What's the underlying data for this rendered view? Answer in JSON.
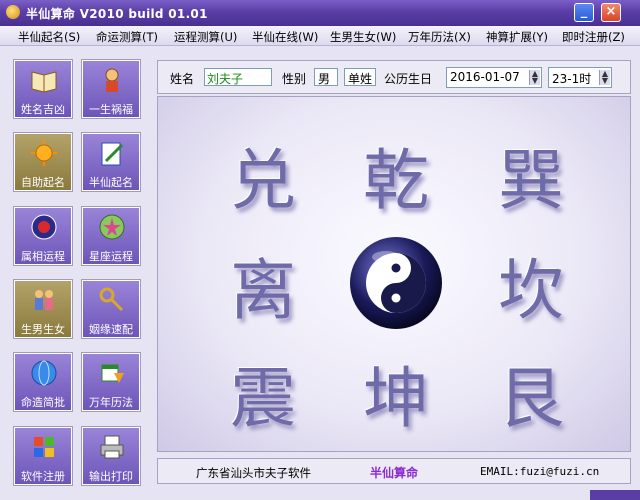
{
  "window": {
    "title": "半仙算命 V2010 build 01.01",
    "min_glyph": "_",
    "close_glyph": "×"
  },
  "menu": [
    "半仙起名(S)",
    "命运测算(T)",
    "运程测算(U)",
    "半仙在线(W)",
    "生男生女(W)",
    "万年历法(X)",
    "神算扩展(Y)",
    "即时注册(Z)"
  ],
  "sidebar": [
    {
      "label": "姓名吉凶",
      "icon": "book-icon"
    },
    {
      "label": "一生祸福",
      "icon": "figure-icon"
    },
    {
      "label": "自助起名",
      "icon": "sun-icon",
      "active": true
    },
    {
      "label": "半仙起名",
      "icon": "pen-paper-icon"
    },
    {
      "label": "属相运程",
      "icon": "zodiac-wheel-icon"
    },
    {
      "label": "星座运程",
      "icon": "star-globe-icon"
    },
    {
      "label": "生男生女",
      "icon": "kids-icon"
    },
    {
      "label": "姻缘速配",
      "icon": "keys-icon"
    },
    {
      "label": "命造简批",
      "icon": "blue-globe-icon"
    },
    {
      "label": "万年历法",
      "icon": "calendar-icon"
    },
    {
      "label": "软件注册",
      "icon": "windows-logo-icon"
    },
    {
      "label": "输出打印",
      "icon": "printer-icon"
    }
  ],
  "form": {
    "name_label": "姓名",
    "name_value": "刘夫子",
    "gender_label": "性别",
    "gender_value": "男",
    "surname_type": "单姓",
    "birth_label": "公历生日",
    "birth_date": "2016-01-07",
    "birth_hour": "23-1时"
  },
  "trigrams": {
    "top_left": "兑",
    "top_center": "乾",
    "top_right": "巽",
    "mid_left": "离",
    "mid_right": "坎",
    "bottom_left": "震",
    "bottom_center": "坤",
    "bottom_right": "艮"
  },
  "center_icon": "yin-yang-icon",
  "status": {
    "company": "广东省汕头市夫子软件",
    "product": "半仙算命",
    "email": "EMAIL:fuzi@fuzi.cn"
  },
  "colors": {
    "title_bar": "#5a3ea6",
    "button": "#6c55b8",
    "active_button": "#8a7a3c",
    "name_text": "#1a8a1a",
    "product_text": "#8a2ad0"
  }
}
